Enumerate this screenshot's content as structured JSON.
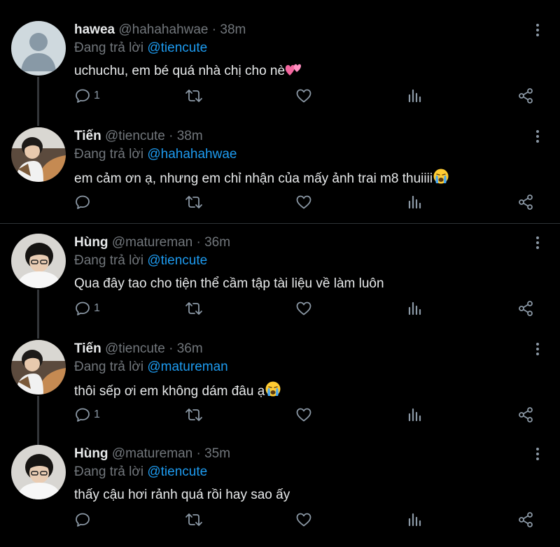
{
  "tweets": [
    {
      "name": "hawea",
      "handle": "@hahahahwae",
      "time": "· 38m",
      "reply_prefix": "Đang trả lời",
      "reply_to": "@tiencute",
      "text": "uchuchu, em bé quá nhà chị cho nè",
      "emoji": "hearts",
      "reply_count": "1",
      "avatar": "default"
    },
    {
      "name": "Tiến",
      "handle": "@tiencute",
      "time": "· 38m",
      "reply_prefix": "Đang trả lời",
      "reply_to": "@hahahahwae",
      "text": "em cảm ơn ạ, nhưng em chỉ nhận của mấy ảnh trai m8 thuiiii",
      "emoji": "crying",
      "reply_count": "",
      "avatar": "tien"
    },
    {
      "name": "Hùng",
      "handle": "@matureman",
      "time": "· 36m",
      "reply_prefix": "Đang trả lời",
      "reply_to": "@tiencute",
      "text": "Qua đây tao cho tiện thể cầm tập tài liệu về làm luôn",
      "emoji": "",
      "reply_count": "1",
      "avatar": "hung"
    },
    {
      "name": "Tiến",
      "handle": "@tiencute",
      "time": "· 36m",
      "reply_prefix": "Đang trả lời",
      "reply_to": "@matureman",
      "text": "thôi sếp ơi em không dám đâu ạ",
      "emoji": "crying",
      "reply_count": "1",
      "avatar": "tien"
    },
    {
      "name": "Hùng",
      "handle": "@matureman",
      "time": "· 35m",
      "reply_prefix": "Đang trả lời",
      "reply_to": "@tiencute",
      "text": "thấy cậu hơi rảnh quá rồi hay sao ấy",
      "emoji": "",
      "reply_count": "",
      "avatar": "hung"
    }
  ],
  "colors": {
    "background": "#000000",
    "mention": "#1d9bf0",
    "muted": "#71767b",
    "text": "#e7e9ea"
  },
  "icons": [
    "reply-icon",
    "retweet-icon",
    "like-icon",
    "analytics-icon",
    "share-icon",
    "more-icon"
  ]
}
